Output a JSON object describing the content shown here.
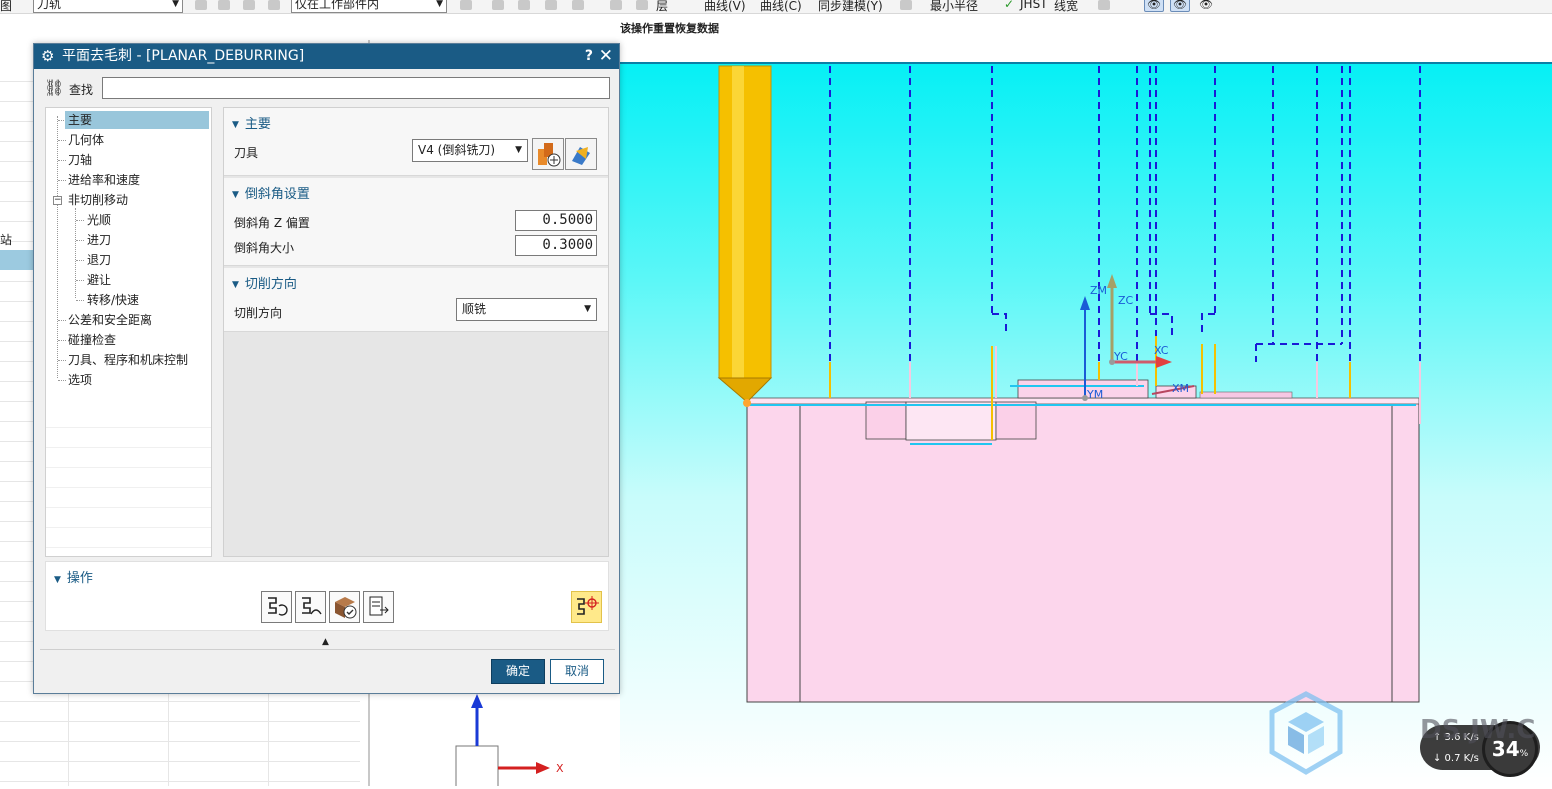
{
  "toolbar": {
    "left_fragment": "图",
    "combo1": "刀轨",
    "combo2": "仅在工作部件内",
    "layer_label": "层",
    "curve_label1": "曲线(V)",
    "curve_label2": "曲线(C)",
    "sync_label": "同步建模(Y)",
    "edit_label": "最小半径",
    "jhst_label": "JHST",
    "line_label": "线宽"
  },
  "status_message": "该操作重置恢复数据",
  "navigator": {
    "edge_text": "站"
  },
  "dialog": {
    "title": "平面去毛刺 - [PLANAR_DEBURRING]",
    "help": "?",
    "close": "✕",
    "find_label": "查找",
    "tree": [
      {
        "label": "主要",
        "selected": true
      },
      {
        "label": "几何体"
      },
      {
        "label": "刀轴"
      },
      {
        "label": "进给率和速度"
      },
      {
        "label": "非切削移动"
      },
      {
        "label": "光顺"
      },
      {
        "label": "进刀"
      },
      {
        "label": "退刀"
      },
      {
        "label": "避让"
      },
      {
        "label": "转移/快速"
      },
      {
        "label": "公差和安全距离"
      },
      {
        "label": "碰撞检查"
      },
      {
        "label": "刀具、程序和机床控制"
      },
      {
        "label": "选项"
      }
    ],
    "main_group": {
      "header": "主要",
      "tool_label": "刀具",
      "tool_value": "V4 (倒斜铣刀)"
    },
    "chamfer_group": {
      "header": "倒斜角设置",
      "z_offset_label": "倒斜角 Z 偏置",
      "z_offset_value": "0.5000",
      "size_label": "倒斜角大小",
      "size_value": "0.3000"
    },
    "cut_dir_group": {
      "header": "切削方向",
      "label": "切削方向",
      "value": "顺铣"
    },
    "ops_header": "操作",
    "ok": "确定",
    "cancel": "取消"
  },
  "viewport": {
    "labels": {
      "zm": "ZM",
      "zc": "ZC",
      "yc": "YC",
      "xc": "XC",
      "ym": "YM",
      "xm": "XM",
      "x_axis": "X"
    }
  },
  "overlay": {
    "net_up": "↑ 3.6 K/s",
    "net_down": "↓ 0.7 K/s",
    "cpu": "34",
    "cpu_unit": "%",
    "watermark": "DS.JW.C"
  },
  "colors": {
    "title_bar": "#1a5b85",
    "accent": "#1a5b85",
    "viewport_top": "#06f0f5",
    "part_fill": "#fcd6ec",
    "tool_yellow": "#f5c000",
    "toolpath_blue": "#1a1ad6"
  }
}
